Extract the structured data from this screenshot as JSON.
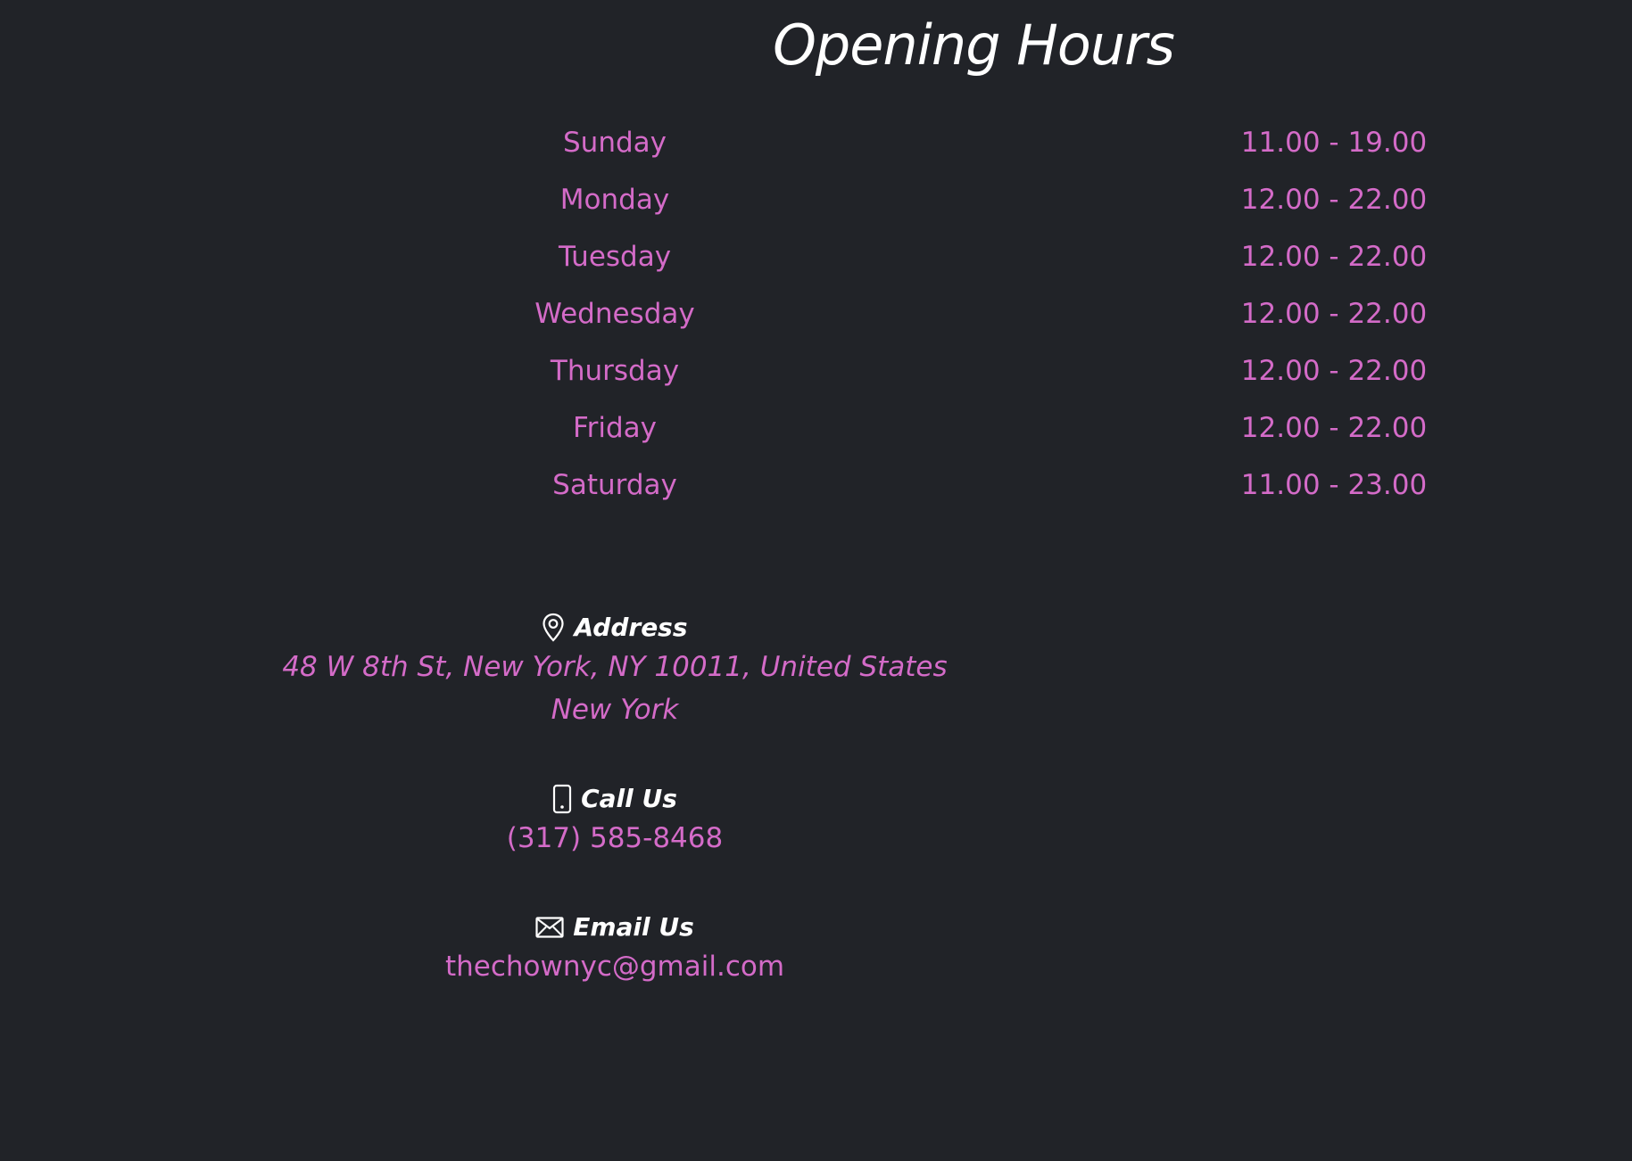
{
  "title": "Opening Hours",
  "hours": [
    {
      "day": "Sunday",
      "time": "11.00 - 19.00"
    },
    {
      "day": "Monday",
      "time": "12.00 - 22.00"
    },
    {
      "day": "Tuesday",
      "time": "12.00 - 22.00"
    },
    {
      "day": "Wednesday",
      "time": "12.00 - 22.00"
    },
    {
      "day": "Thursday",
      "time": "12.00 - 22.00"
    },
    {
      "day": "Friday",
      "time": "12.00 - 22.00"
    },
    {
      "day": "Saturday",
      "time": "11.00 - 23.00"
    }
  ],
  "address": {
    "label": "Address",
    "icon": "map-pin-icon",
    "line1": "48 W 8th St, New York, NY 10011, United States",
    "line2": "New York"
  },
  "call": {
    "label": "Call Us",
    "icon": "phone-icon",
    "value": "(317) 585-8468"
  },
  "email": {
    "label": "Email Us",
    "icon": "envelope-icon",
    "value": "thechownyc@gmail.com"
  },
  "colors": {
    "background": "#212328",
    "accent": "#d46bc8",
    "heading": "#ffffff"
  }
}
